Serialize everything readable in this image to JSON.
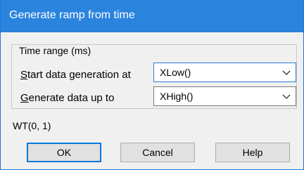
{
  "window": {
    "title": "Generate ramp from time"
  },
  "time_range": {
    "group_label": "Time range (ms)",
    "start_label_mnemonic": "S",
    "start_label_rest": "tart data generation at",
    "start_value": "XLow()",
    "end_label_mnemonic": "G",
    "end_label_rest": "enerate data up to",
    "end_value": "XHigh()"
  },
  "formula_text": "WT(0, 1)",
  "buttons": {
    "ok": "OK",
    "cancel": "Cancel",
    "help": "Help"
  },
  "colors": {
    "titlebar": "#2a84dd",
    "accent": "#0078d7"
  }
}
